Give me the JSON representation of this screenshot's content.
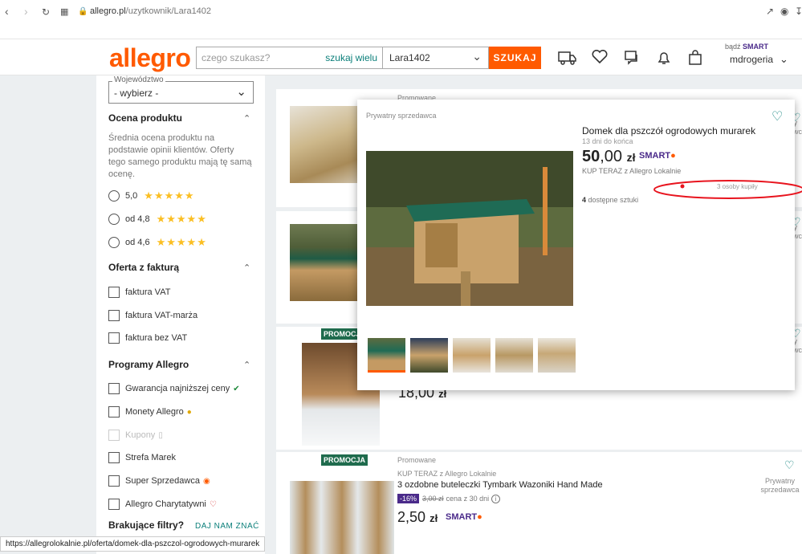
{
  "browser": {
    "url_host": "allegro.pl",
    "url_path": "/uzytkownik/Lara1402",
    "status_url": "https://allegrolokalnie.pl/oferta/domek-dla-pszczol-ogrodowych-murarek"
  },
  "header": {
    "logo": "allegro",
    "search_placeholder": "czego szukasz?",
    "search_many": "szukaj wielu",
    "search_category": "Lara1402",
    "search_button": "SZUKAJ",
    "be_label": "bądź",
    "smart_label": "SMART",
    "username": "mdrogeria"
  },
  "sidebar": {
    "wojewodztwo_label": "Województwo",
    "wojewodztwo_value": "- wybierz -",
    "rating_title": "Ocena produktu",
    "rating_desc": "Średnia ocena produktu na podstawie opinii klientów. Oferty tego samego produktu mają tę samą ocenę.",
    "ratings": [
      "5,0",
      "od 4,8",
      "od 4,6"
    ],
    "invoice_title": "Oferta z fakturą",
    "invoice_opts": [
      "faktura VAT",
      "faktura VAT-marża",
      "faktura bez VAT"
    ],
    "programs_title": "Programy Allegro",
    "programs": [
      "Gwarancja najniższej ceny",
      "Monety Allegro",
      "Kupony",
      "Strefa Marek",
      "Super Sprzedawca",
      "Allegro Charytatywni"
    ],
    "missing_filters": "Brakujące filtry?",
    "give_feedback": "DAJ NAM ZNAĆ"
  },
  "listings": {
    "promowane": "Promowane",
    "promocja": "PROMOCJA",
    "card3_price": "18,00",
    "card4_kup": "KUP TERAZ z Allegro Lokalnie",
    "card4_title": "3 ozdobne buteleczki Tymbark Wazoniki Hand Made",
    "card4_discount": "-16%",
    "card4_oldprice": "3,00 zł",
    "card4_oldprice_note": "cena z 30 dni",
    "card4_price": "2,50",
    "currency": "zł",
    "private_seller": "Prywatny sprzedawca",
    "private_seller_l1": "Prywatny",
    "private_seller_l2": "sprzedawca"
  },
  "popup": {
    "seller": "Prywatny sprzedawca",
    "title": "Domek dla pszczół ogrodowych murarek",
    "days_left": "13 dni do końca",
    "price_int": "50",
    "price_dec": ",00",
    "currency": "zł",
    "smart": "SMART",
    "kup_teraz": "KUP TERAZ z Allegro Lokalnie",
    "bought": "3 osoby kupiły",
    "avail_count": "4",
    "avail_text": "dostępne sztuki"
  }
}
